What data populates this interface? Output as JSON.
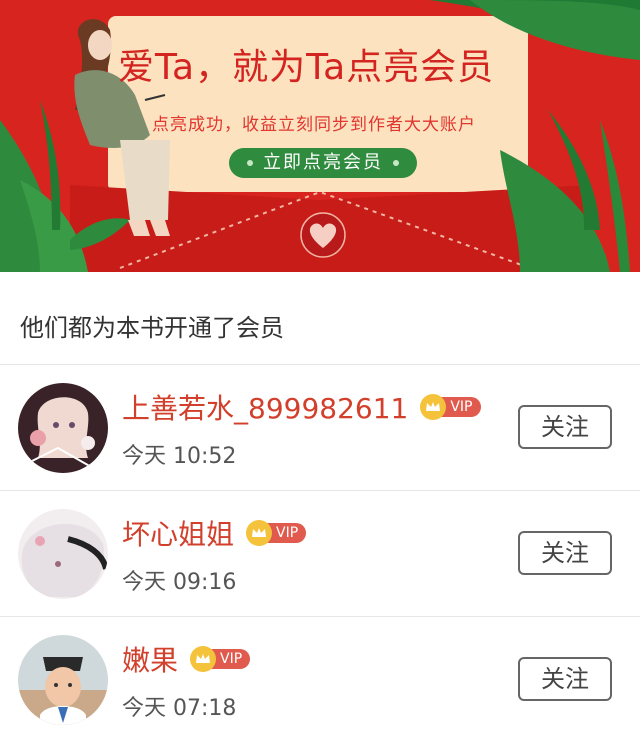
{
  "banner": {
    "title": "爱Ta，就为Ta点亮会员",
    "subtitle": "点亮成功，收益立刻同步到作者大大账户",
    "button_label": "立即点亮会员",
    "colors": {
      "background": "#d8241f",
      "card": "#fde2c0",
      "button": "#2f8b3e",
      "leaf": "#2e8b3d"
    },
    "icons": [
      "woman-illustration",
      "leaf-decoration",
      "heart-seal-icon"
    ]
  },
  "section": {
    "title": "他们都为本书开通了会员"
  },
  "members": [
    {
      "name": "上善若水_899982611",
      "vip_label": "VIP",
      "time": "今天 10:52",
      "follow_label": "关注",
      "avatar": "anime-girl-flowers-avatar"
    },
    {
      "name": "坏心姐姐",
      "vip_label": "VIP",
      "time": "今天 09:16",
      "follow_label": "关注",
      "avatar": "white-hair-anime-avatar"
    },
    {
      "name": "嫩果",
      "vip_label": "VIP",
      "time": "今天 07:18",
      "follow_label": "关注",
      "avatar": "child-photo-avatar"
    }
  ],
  "colors": {
    "name": "#d2402c",
    "vip_tag": "#e05a4e",
    "crown": "#f4c23b"
  }
}
